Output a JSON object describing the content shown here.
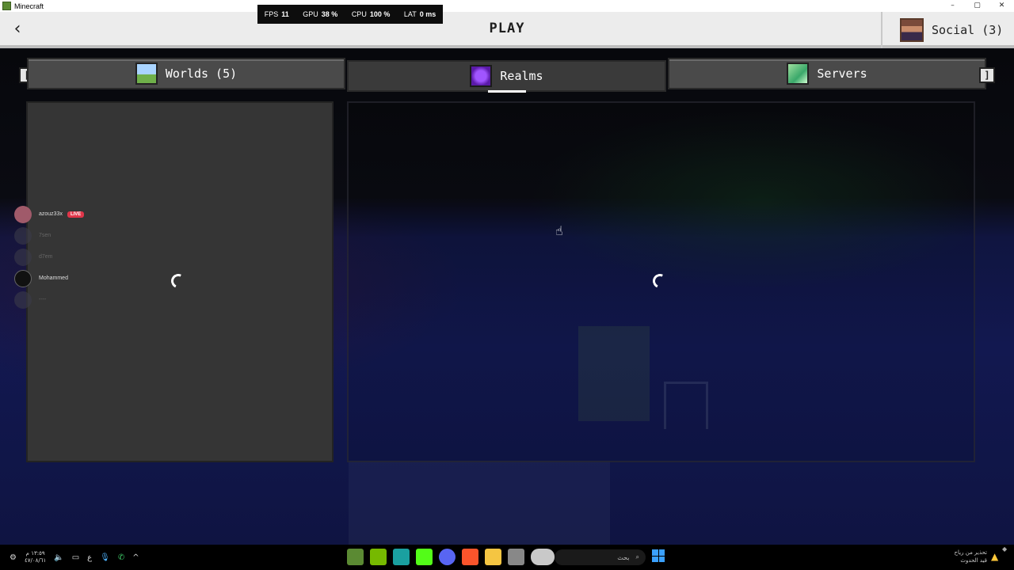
{
  "window": {
    "title": "Minecraft",
    "controls": [
      "–",
      "▢",
      "✕"
    ]
  },
  "perf": [
    {
      "label": "FPS",
      "value": "11"
    },
    {
      "label": "GPU",
      "value": "38 %"
    },
    {
      "label": "CPU",
      "value": "100 %"
    },
    {
      "label": "LAT",
      "value": "0 ms"
    }
  ],
  "header": {
    "back_glyph": "‹",
    "title": "PLAY",
    "social_label": "Social (3)"
  },
  "tabs": [
    {
      "label": "Worlds (5)",
      "icon": "grass-landscape-icon"
    },
    {
      "label": "Realms",
      "icon": "realms-portal-icon",
      "selected": true
    },
    {
      "label": "Servers",
      "icon": "emerald-icon"
    }
  ],
  "bumpers": {
    "left": "[",
    "right": "]"
  },
  "voice_overlay": {
    "users": [
      {
        "name": "azouz33x",
        "live": "LIVE"
      },
      {
        "name": "7sen"
      },
      {
        "name": "d7em"
      },
      {
        "name": "Mohammed"
      },
      {
        "name": "----"
      }
    ]
  },
  "taskbar": {
    "clock_time": "١٣:٥٩ م",
    "clock_date": "٤٧/٠٨/٦١",
    "lang": "ع",
    "search_placeholder": "بحث",
    "notice_line1": "تحذير من رياح",
    "notice_line2": "قيد الحدوث"
  },
  "colors": {
    "accent_live": "#e0364a",
    "header_bg": "#ececec",
    "panel_bg": "#353535"
  }
}
